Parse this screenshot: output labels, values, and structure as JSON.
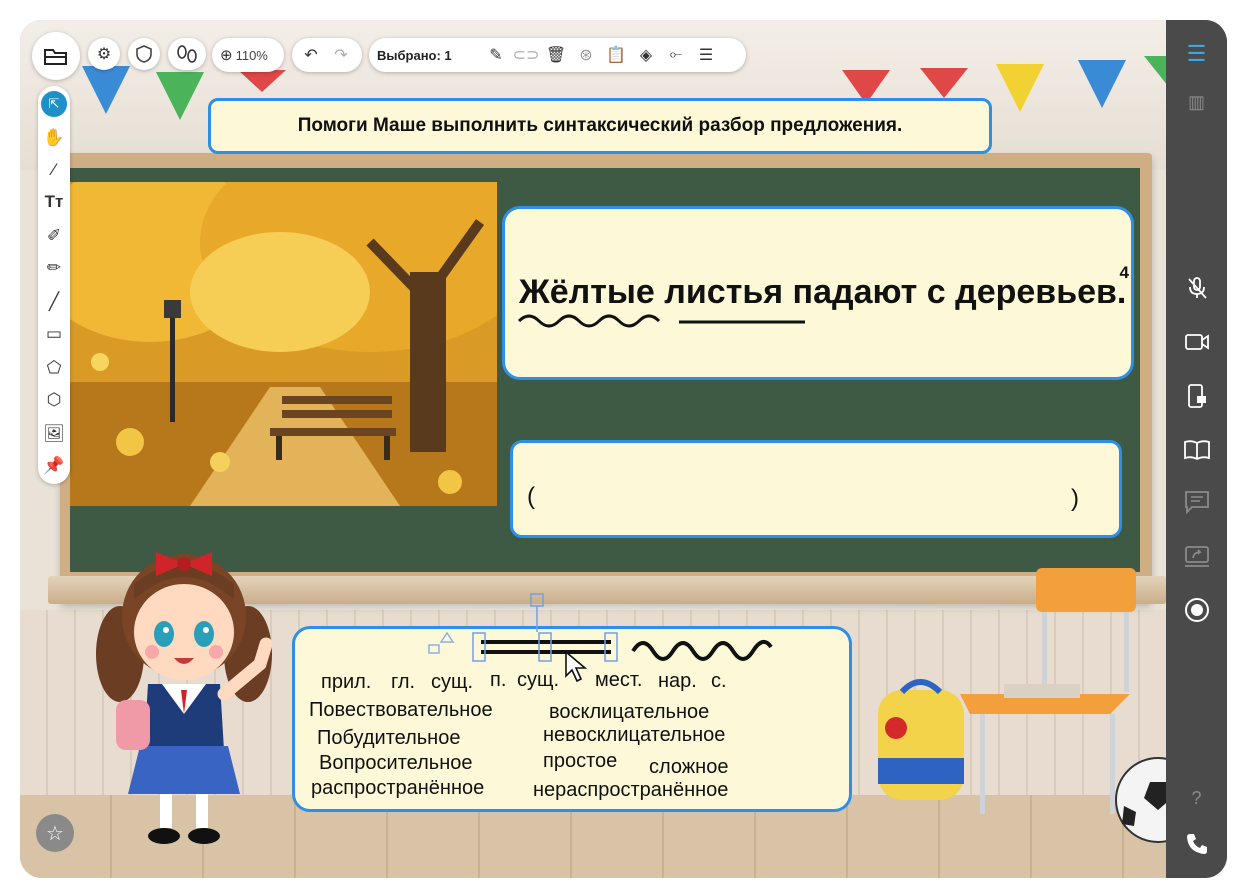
{
  "toolbar": {
    "zoom": "110%",
    "selected_label": "Выбрано: 1"
  },
  "slide": {
    "title": "Помоги Маше выполнить синтаксический разбор предложения.",
    "sentence": {
      "word1": "Жёлтые",
      "word2": "листья",
      "rest": " падают с деревьев.",
      "superscript": "4"
    },
    "answer": {
      "open": "(",
      "close": ")"
    },
    "bank": {
      "parts": [
        "прил.",
        "гл.",
        "сущ.",
        "п.",
        "сущ.",
        "мест.",
        "нар.",
        "с."
      ],
      "words": {
        "narrative": "Повествовательное",
        "exclamatory": "восклицательное",
        "imperative": "Побудительное",
        "non_exclamatory": "невосклицательное",
        "interrogative": "Вопросительное",
        "simple": "простое",
        "complex": "сложное",
        "extended": "распространённое",
        "non_extended": "нераспространённое"
      }
    }
  },
  "sidebar": {
    "help": "?"
  },
  "colors": {
    "accent": "#2e8fe6",
    "card": "#fdf9d8",
    "board": "#3e5a45",
    "sidebar": "#4a4a4a",
    "active_tool": "#1e8fc7"
  },
  "icons": [
    "folder-icon",
    "gear-icon",
    "shield-icon",
    "footprints-icon",
    "zoom-in-icon",
    "undo-icon",
    "redo-icon",
    "dropper-icon",
    "link-icon",
    "trash-icon",
    "group-icon",
    "clipboard-icon",
    "layers-icon",
    "connector-icon",
    "sliders-icon",
    "select-icon",
    "hand-icon",
    "pen-icon",
    "text-icon",
    "brush-icon",
    "marker-icon",
    "line-icon",
    "rectangle-icon",
    "polygon-icon",
    "cube-icon",
    "image-icon",
    "pin-icon",
    "star-icon",
    "menu-icon",
    "layout-icon",
    "mic-off-icon",
    "video-icon",
    "device-lock-icon",
    "book-icon",
    "chat-icon",
    "screen-share-icon",
    "record-icon",
    "help-icon",
    "phone-icon"
  ]
}
